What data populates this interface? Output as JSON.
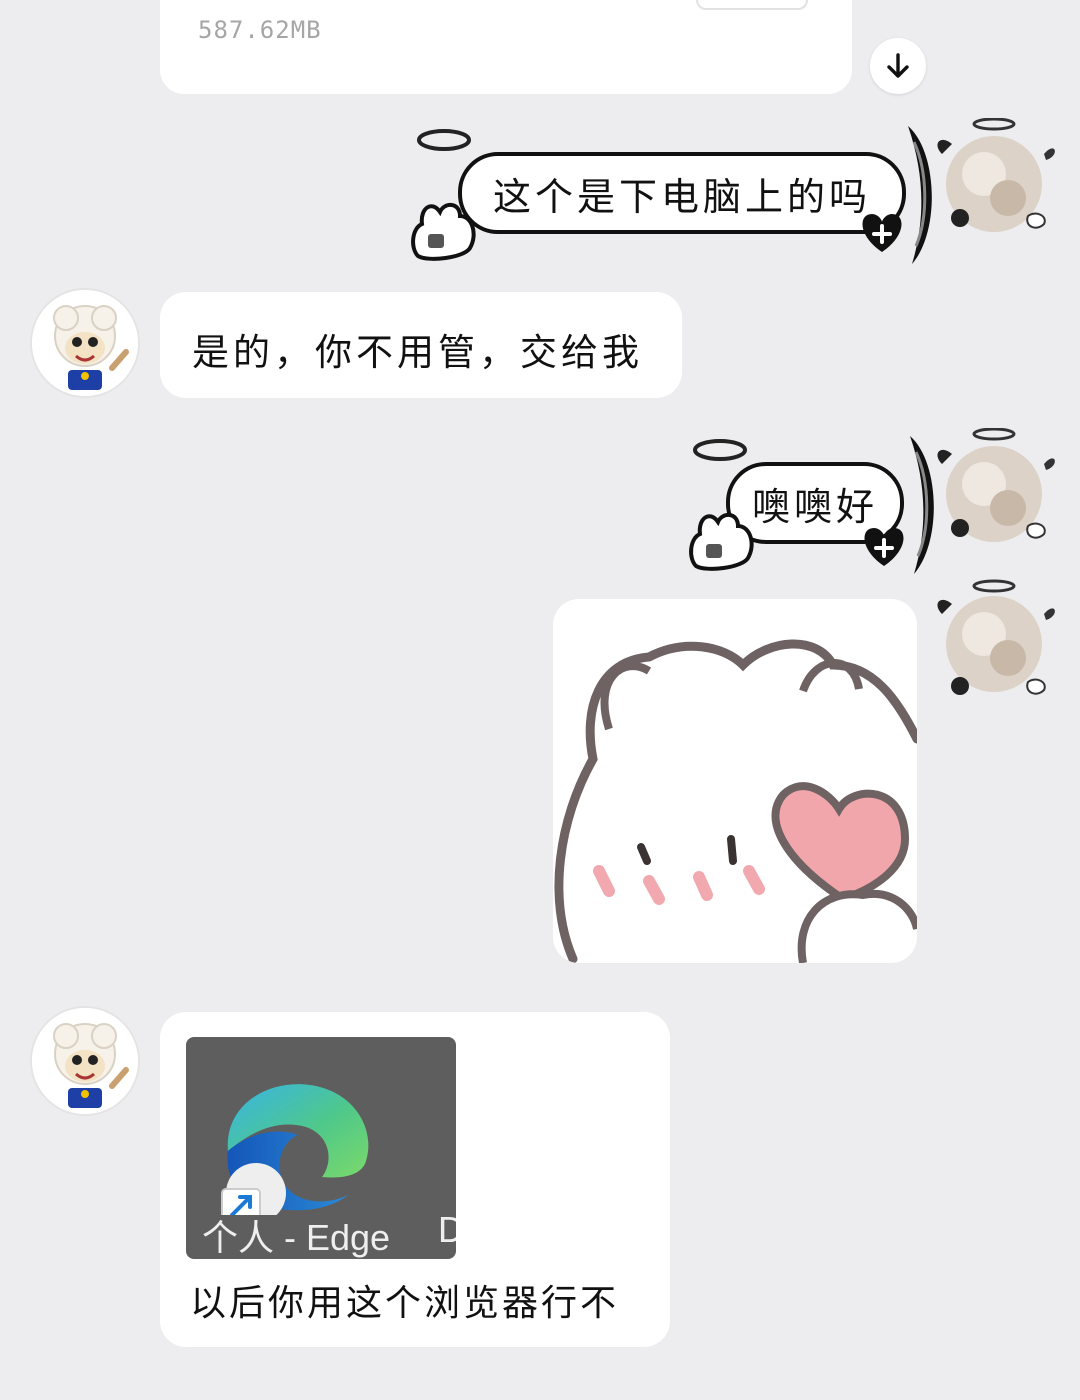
{
  "file_message": {
    "size": "587.62MB"
  },
  "messages": [
    {
      "side": "right",
      "text": "这个是下电脑上的吗"
    },
    {
      "side": "left",
      "text": "是的，你不用管，交给我"
    },
    {
      "side": "right",
      "text": "噢噢好"
    },
    {
      "side": "right",
      "type": "sticker"
    },
    {
      "side": "left",
      "type": "image",
      "image_caption": "个人 - Edge",
      "image_edge_letter": "D",
      "text": "以后你用这个浏览器行不"
    }
  ]
}
